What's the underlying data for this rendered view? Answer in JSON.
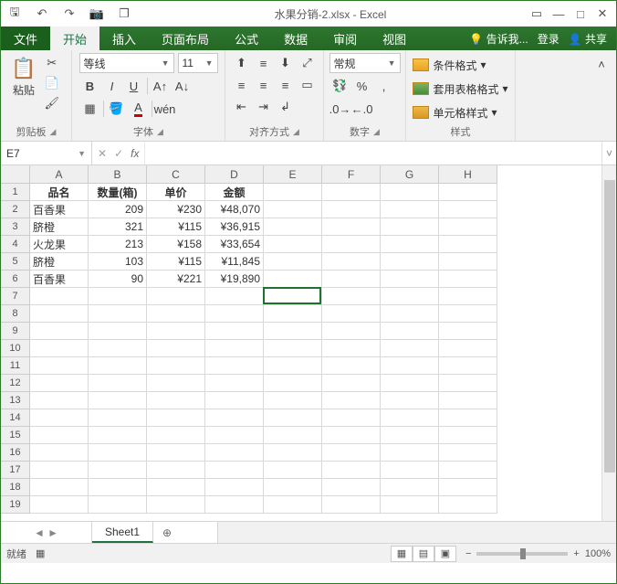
{
  "title": {
    "filename": "水果分销-2.xlsx",
    "app": "Excel"
  },
  "qat": {
    "save": "🖫",
    "undo": "↶",
    "redo": "↷",
    "camera": "📷",
    "window": "❐"
  },
  "tabs": {
    "file": "文件",
    "home": "开始",
    "insert": "插入",
    "pageLayout": "页面布局",
    "formulas": "公式",
    "data": "数据",
    "review": "审阅",
    "view": "视图",
    "tellMe": "告诉我...",
    "signIn": "登录",
    "share": "共享"
  },
  "ribbon": {
    "clipboard": {
      "paste": "粘贴",
      "label": "剪贴板"
    },
    "font": {
      "name": "等线",
      "size": "11",
      "label": "字体",
      "bold": "B",
      "italic": "I",
      "underline": "U"
    },
    "align": {
      "label": "对齐方式"
    },
    "number": {
      "format": "常规",
      "label": "数字"
    },
    "styles": {
      "condFmt": "条件格式",
      "tableFmt": "套用表格格式",
      "cellStyle": "单元格样式",
      "label": "样式"
    }
  },
  "formulaBar": {
    "nameBox": "E7",
    "fx": "fx"
  },
  "grid": {
    "cols": [
      "A",
      "B",
      "C",
      "D",
      "E",
      "F",
      "G",
      "H"
    ],
    "rowCount": 19,
    "headerRow": [
      "品名",
      "数量(箱)",
      "单价",
      "金额"
    ],
    "data": [
      [
        "百香果",
        "209",
        "¥230",
        "¥48,070"
      ],
      [
        "脐橙",
        "321",
        "¥115",
        "¥36,915"
      ],
      [
        "火龙果",
        "213",
        "¥158",
        "¥33,654"
      ],
      [
        "脐橙",
        "103",
        "¥115",
        "¥11,845"
      ],
      [
        "百香果",
        "90",
        "¥221",
        "¥19,890"
      ]
    ],
    "selection": {
      "col": 4,
      "row": 6
    }
  },
  "sheetTabs": {
    "sheet1": "Sheet1"
  },
  "status": {
    "ready": "就绪",
    "zoom": "100%"
  }
}
